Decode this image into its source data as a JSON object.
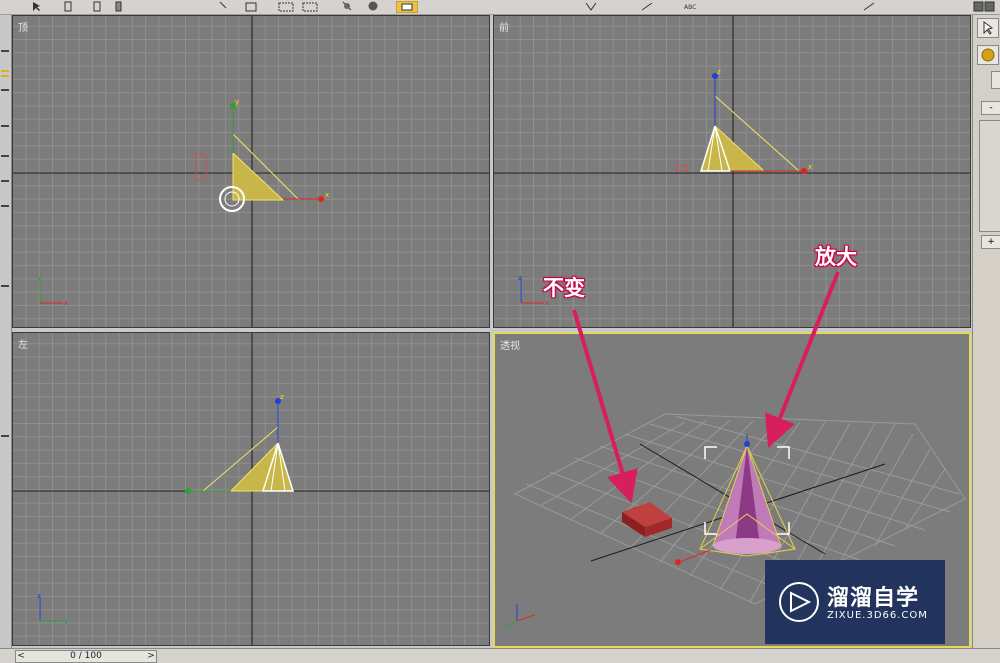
{
  "viewports": {
    "top": {
      "label": "顶"
    },
    "front": {
      "label": "前"
    },
    "left": {
      "label": "左"
    },
    "perspective": {
      "label": "透视"
    }
  },
  "annotations": {
    "unchanged": "不变",
    "enlarge": "放大"
  },
  "timeline": {
    "frame": "0 / 100",
    "prev_label": "<",
    "next_label": ">"
  },
  "watermark": {
    "title": "溜溜自学",
    "url": "ZIXUE.3D66.COM"
  },
  "toolbar": {
    "icons": [
      "select-icon",
      "link-icon",
      "unlink-icon",
      "bind-icon",
      "select-region-icon",
      "window-crossing-icon",
      "move-icon",
      "rotate-icon",
      "scale-icon",
      "abc-icon",
      "mirror-icon"
    ]
  },
  "right_panel": {
    "icons": [
      "cursor-icon",
      "sphere-icon",
      "minus-button",
      "plus-button"
    ]
  },
  "colors": {
    "viewport_bg": "#7c7c7c",
    "grid_line": "#8f8f8f",
    "axis_line": "#1a1a1a",
    "active_border": "#e7d75a",
    "selection": "#e8d84f",
    "callout_arrow": "#d81e5b",
    "axis_x": "#e0261c",
    "axis_y": "#2ea036",
    "axis_z": "#2240d0"
  }
}
